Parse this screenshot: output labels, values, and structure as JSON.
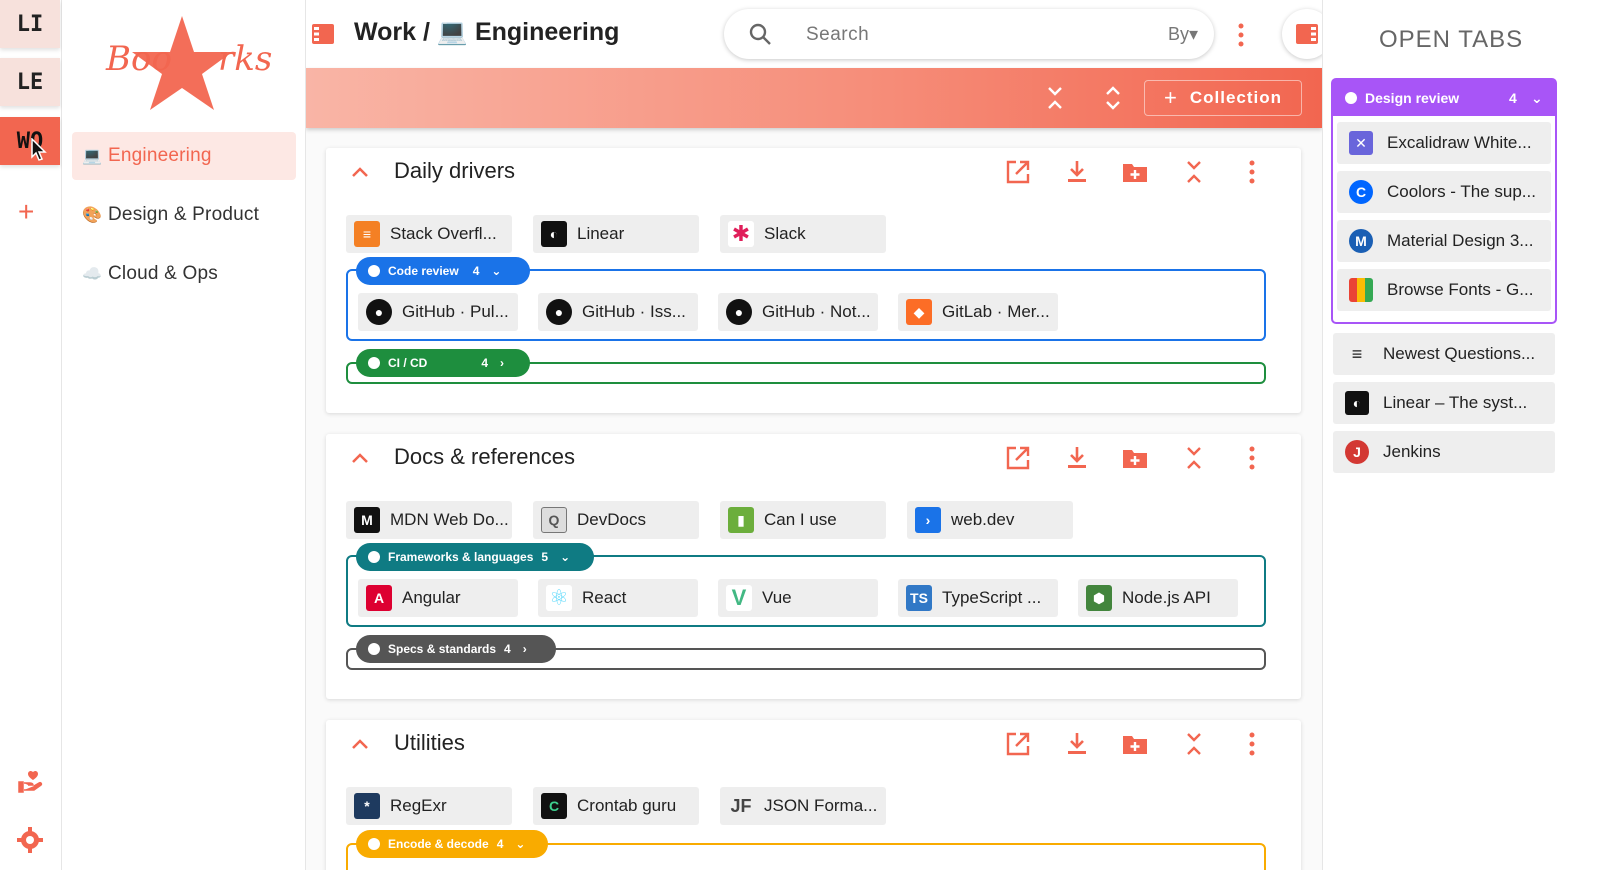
{
  "rail": {
    "workspaces": [
      {
        "label": "LI",
        "active": false
      },
      {
        "label": "LE",
        "active": false
      },
      {
        "label": "WO",
        "active": true
      }
    ],
    "add_label": "+"
  },
  "sidebar": {
    "logo_text": "Bookmarks",
    "items": [
      {
        "label": "Engineering",
        "emoji": "💻",
        "active": true
      },
      {
        "label": "Design & Product",
        "emoji": "🎨",
        "active": false
      },
      {
        "label": "Cloud & Ops",
        "emoji": "☁️",
        "active": false
      }
    ]
  },
  "header": {
    "breadcrumb": "Work / 💻 Engineering",
    "search_placeholder": "Search",
    "search_by": "By▾",
    "collection_button": "Collection"
  },
  "collections": [
    {
      "title": "Daily drivers",
      "bookmarks": [
        {
          "label": "Stack Overfl...",
          "icon": "stackoverflow-icon",
          "color": "#f48024"
        },
        {
          "label": "Linear",
          "icon": "linear-icon",
          "color": "#111111"
        },
        {
          "label": "Slack",
          "icon": "slack-icon",
          "color": "#e01e5a"
        }
      ],
      "groups": [
        {
          "name": "Code review",
          "count": "4",
          "color": "#1a73e8",
          "expanded": true,
          "bookmarks": [
            {
              "label": "GitHub · Pul...",
              "icon": "github-icon"
            },
            {
              "label": "GitHub · Iss...",
              "icon": "github-icon"
            },
            {
              "label": "GitHub · Not...",
              "icon": "github-icon"
            },
            {
              "label": "GitLab · Mer...",
              "icon": "gitlab-icon"
            }
          ]
        },
        {
          "name": "CI / CD",
          "count": "4",
          "color": "#1e8e3e",
          "expanded": false
        }
      ]
    },
    {
      "title": "Docs & references",
      "bookmarks": [
        {
          "label": "MDN Web Do...",
          "icon": "mdn-icon",
          "color": "#111111"
        },
        {
          "label": "DevDocs",
          "icon": "devdocs-icon",
          "color": "#555555"
        },
        {
          "label": "Can I use",
          "icon": "caniuse-icon",
          "color": "#6cae3c"
        },
        {
          "label": "web.dev",
          "icon": "webdev-icon",
          "color": "#1a73e8"
        }
      ],
      "groups": [
        {
          "name": "Frameworks & languages",
          "count": "5",
          "color": "#0f7b83",
          "expanded": true,
          "bookmarks": [
            {
              "label": "Angular",
              "icon": "angular-icon"
            },
            {
              "label": "React",
              "icon": "react-icon"
            },
            {
              "label": "Vue",
              "icon": "vue-icon"
            },
            {
              "label": "TypeScript ...",
              "icon": "typescript-icon"
            },
            {
              "label": "Node.js API",
              "icon": "nodejs-icon"
            }
          ]
        },
        {
          "name": "Specs & standards",
          "count": "4",
          "color": "#555555",
          "expanded": false
        }
      ]
    },
    {
      "title": "Utilities",
      "bookmarks": [
        {
          "label": "RegExr",
          "icon": "regexr-icon",
          "color": "#1e3a5f"
        },
        {
          "label": "Crontab guru",
          "icon": "crontab-icon",
          "color": "#111111"
        },
        {
          "label": "JSON Forma...",
          "icon": "json-icon",
          "color": "#444444"
        }
      ],
      "groups": [
        {
          "name": "Encode & decode",
          "count": "4",
          "color": "#f9ab00",
          "expanded": true
        }
      ]
    }
  ],
  "right_panel": {
    "title": "OPEN TABS",
    "group": {
      "name": "Design review",
      "count": "4",
      "color": "#a855f7",
      "tabs": [
        {
          "label": "Excalidraw White...",
          "icon": "excalidraw-icon"
        },
        {
          "label": "Coolors - The sup...",
          "icon": "coolors-icon"
        },
        {
          "label": "Material Design 3...",
          "icon": "material-icon"
        },
        {
          "label": "Browse Fonts - G...",
          "icon": "googlefonts-icon"
        }
      ]
    },
    "tabs": [
      {
        "label": "Newest Questions...",
        "icon": "stackoverflow-icon"
      },
      {
        "label": "Linear – The syst...",
        "icon": "linear-icon"
      },
      {
        "label": "Jenkins",
        "icon": "jenkins-icon"
      }
    ]
  },
  "colors": {
    "accent": "#f26650",
    "accent_light": "#fde8e4"
  }
}
